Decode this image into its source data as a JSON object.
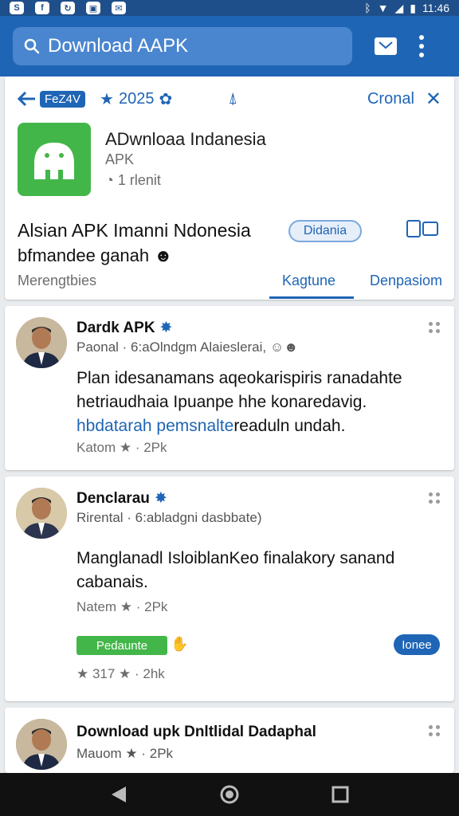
{
  "status_bar": {
    "time": "11:46"
  },
  "search": {
    "placeholder": "Download AAPK"
  },
  "header": {
    "tag": "FeZ4V",
    "rating": "2025",
    "general_label": "Cronal",
    "app_title": "ADwnloaa Indanesia",
    "app_subtitle": "APK",
    "app_meta": "1 rlenit",
    "headline": "Alsian APK Imanni Ndonesia",
    "chip_label": "Didania",
    "subline": "bfmandee ganah",
    "tabs": [
      "Merengtbies",
      "Kagtune",
      "Denpasiom"
    ]
  },
  "posts": [
    {
      "name": "Dardk APK",
      "meta": "Paonal · 6:aOlndgm Alaieslerai,",
      "body_line1": "Plan idesanamans aqeokarispiris ranadahte",
      "body_line2": "hetriaudhaia Ipuanpe hhe konaredavig.",
      "body_link": "hbdatarah pemsnaltе",
      "body_tail": "readuln undah.",
      "footer": "Katom ★ · 2Pk"
    },
    {
      "name": "Denclarau",
      "meta": "Rirental · 6:abladgni dasbbate)",
      "body_line1": "Manglanadl IsloiblanKeo finalakory sanand",
      "body_line2": "cabanais.",
      "footer": "Natem ★ · 2Pk",
      "green_button": "Pedaunte",
      "blue_pill": "Ionee",
      "stats": "★ 317 ★ · 2hk"
    },
    {
      "name": "Download upk Dnltlidal Dadaphal",
      "meta": "Mauom ★ · 2Pk"
    }
  ]
}
